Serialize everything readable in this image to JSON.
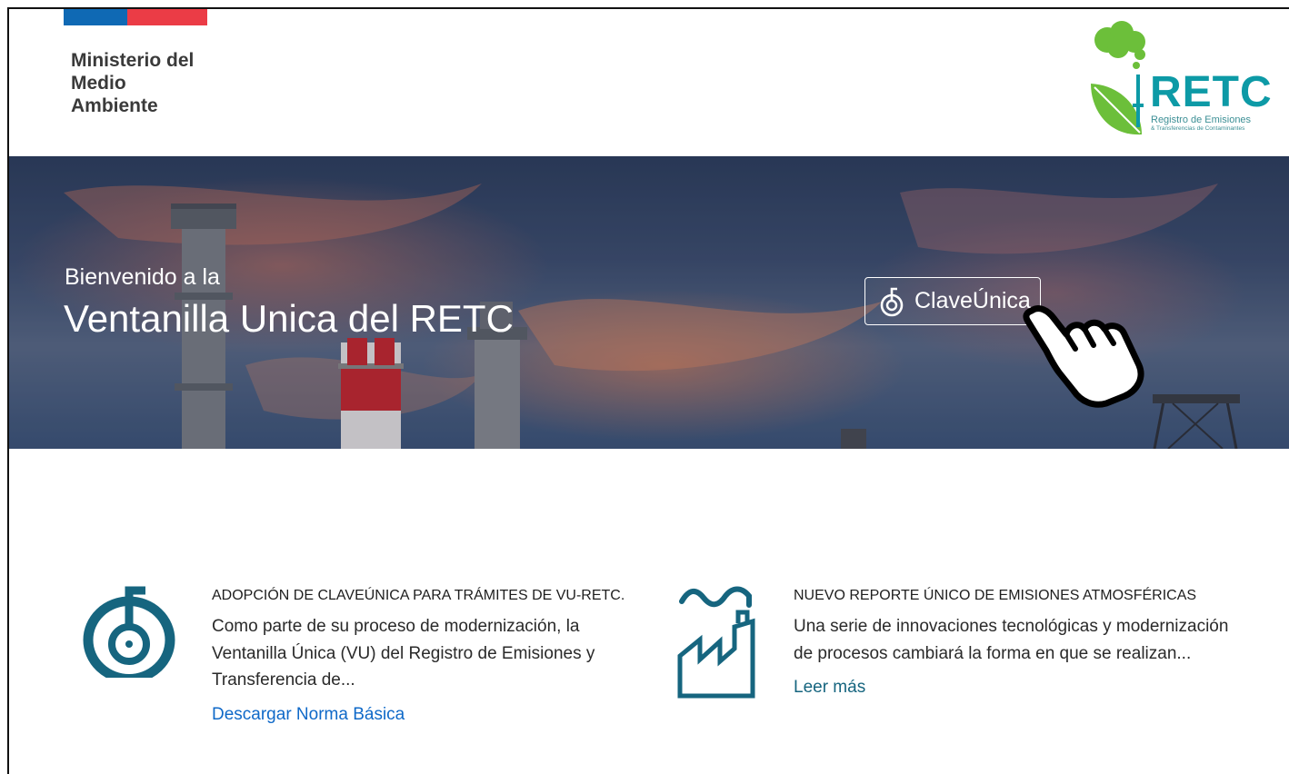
{
  "header": {
    "ministry_lines": [
      "Ministerio del",
      "Medio",
      "Ambiente"
    ],
    "logo": {
      "word": "RETC",
      "sub_line1": "Registro de Emisiones",
      "sub_line2": "& Transferencias de Contaminantes"
    }
  },
  "hero": {
    "welcome": "Bienvenido a la",
    "title": "Ventanilla Unica del RETC",
    "login_button_label": "ClaveÚnica"
  },
  "cards": [
    {
      "icon": "claveunica-icon",
      "title": "ADOPCIÓN DE CLAVEÚNICA PARA TRÁMITES DE VU-RETC.",
      "body": "Como parte de su proceso de modernización, la Ventanilla Única (VU) del Registro de Emisiones y Transferencia de...",
      "link": "Descargar Norma Básica"
    },
    {
      "icon": "factory-icon",
      "title": "NUEVO REPORTE ÚNICO DE EMISIONES ATMOSFÉRICAS",
      "body": "Una serie de innovaciones tecnológicas y modernización de procesos cambiará la forma en que se realizan...",
      "link": "Leer más"
    }
  ],
  "colors": {
    "gob_blue": "#0f69b4",
    "gob_red": "#eb3c46",
    "icon_teal": "#16657f",
    "link_blue": "#0f69c8",
    "retc_teal": "#0d9aa6",
    "retc_green": "#6cbf3a"
  }
}
